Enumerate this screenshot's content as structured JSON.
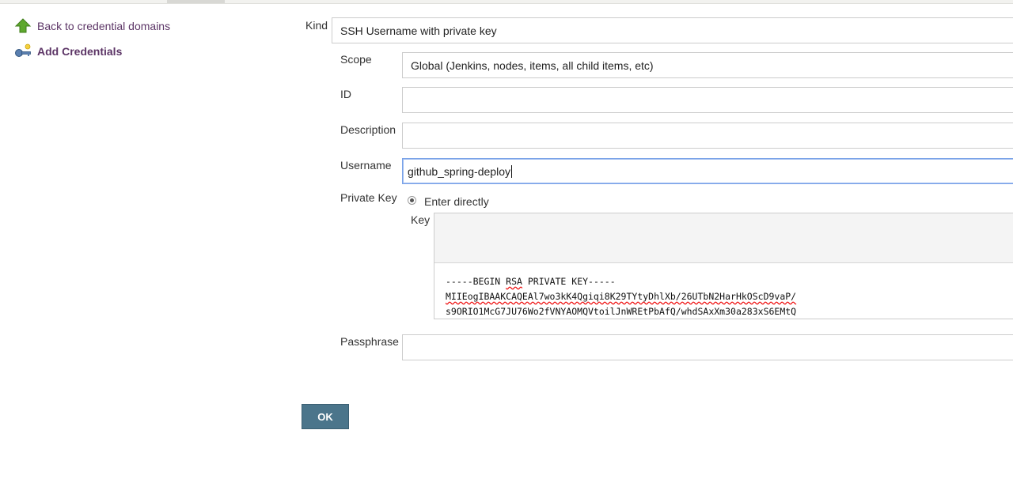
{
  "sidebar": {
    "back_label": "Back to credential domains",
    "add_label": "Add Credentials"
  },
  "form": {
    "kind_label": "Kind",
    "kind_value": "SSH Username with private key",
    "scope_label": "Scope",
    "scope_value": "Global (Jenkins, nodes, items, all child items, etc)",
    "id_label": "ID",
    "id_value": "",
    "description_label": "Description",
    "description_value": "",
    "username_label": "Username",
    "username_value": "github_spring-deploy",
    "private_key_label": "Private Key",
    "enter_directly_label": "Enter directly",
    "key_label": "Key",
    "key_line1_a": "-----BEGIN ",
    "key_line1_b": "RSA",
    "key_line1_c": " PRIVATE KEY-----",
    "key_line2": "MIIEogIBAAKCAQEAl7wo3kK4Qgiqi8K29TYtyDhlXb/26UTbN2HarHkOScD9vaP/",
    "key_line3": "s9ORIO1McG7JU76Wo2fVNYAOMQVtoilJnWREtPbAfQ/whdSAxXm30a283xS6EMtQ",
    "passphrase_label": "Passphrase",
    "passphrase_value": ""
  },
  "buttons": {
    "ok_label": "OK"
  },
  "colors": {
    "link": "#5c3566",
    "button": "#4b758b",
    "focus_border": "#7aa3e8"
  }
}
